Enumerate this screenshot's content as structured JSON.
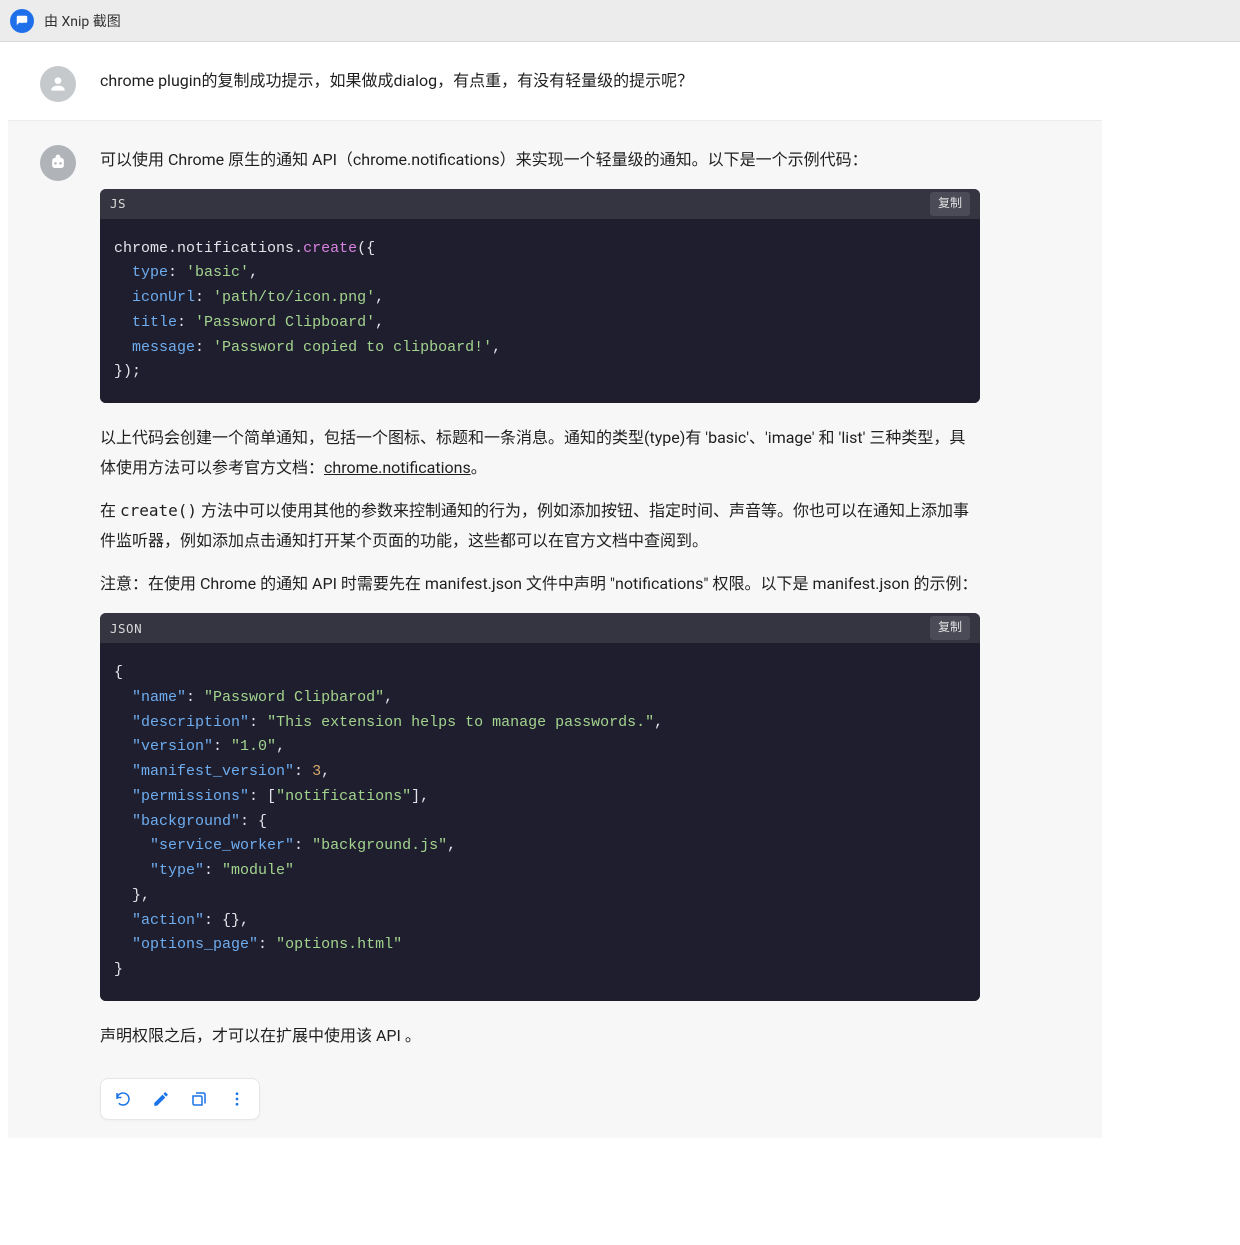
{
  "titlebar": {
    "text": "由 Xnip 截图"
  },
  "user": {
    "text": "chrome plugin的复制成功提示，如果做成dialog，有点重，有没有轻量级的提示呢？"
  },
  "assistant": {
    "intro": "可以使用 Chrome 原生的通知 API（chrome.notifications）来实现一个轻量级的通知。以下是一个示例代码：",
    "code1": {
      "lang": "JS",
      "copy": "复制",
      "lines": {
        "l1a": "chrome",
        "l1b": ".",
        "l1c": "notifications",
        "l1d": ".",
        "l1e": "create",
        "l1f": "({",
        "typeKey": "type",
        "typeVal": "'basic'",
        "iconKey": "iconUrl",
        "iconVal": "'path/to/icon.png'",
        "titleKey": "title",
        "titleVal": "'Password Clipboard'",
        "msgKey": "message",
        "msgVal": "'Password copied to clipboard!'",
        "end": "});"
      }
    },
    "p2a": "以上代码会创建一个简单通知，包括一个图标、标题和一条消息。通知的类型(type)有 'basic'、'image' 和 'list' 三种类型，具体使用方法可以参考官方文档：",
    "p2link": "chrome.notifications",
    "p2b": "。",
    "p3_pre": "在 ",
    "p3_code": "create()",
    "p3_post": " 方法中可以使用其他的参数来控制通知的行为，例如添加按钮、指定时间、声音等。你也可以在通知上添加事件监听器，例如添加点击通知打开某个页面的功能，这些都可以在官方文档中查阅到。",
    "p4": "注意：在使用 Chrome 的通知 API 时需要先在 manifest.json 文件中声明 \"notifications\" 权限。以下是 manifest.json 的示例：",
    "code2": {
      "lang": "JSON",
      "copy": "复制",
      "json": {
        "open": "{",
        "nameK": "\"name\"",
        "nameV": "\"Password Clipbarod\"",
        "descK": "\"description\"",
        "descV": "\"This extension helps to manage passwords.\"",
        "verK": "\"version\"",
        "verV": "\"1.0\"",
        "mvK": "\"manifest_version\"",
        "mvV": "3",
        "permK": "\"permissions\"",
        "permV": "\"notifications\"",
        "bgK": "\"background\"",
        "swK": "\"service_worker\"",
        "swV": "\"background.js\"",
        "typeK": "\"type\"",
        "typeV": "\"module\"",
        "actK": "\"action\"",
        "optK": "\"options_page\"",
        "optV": "\"options.html\"",
        "close": "}"
      }
    },
    "p5": "声明权限之后，才可以在扩展中使用该 API 。"
  },
  "actions": {
    "regenerate": "regenerate-icon",
    "edit": "edit-icon",
    "copy": "copy-icon",
    "more": "more-icon"
  }
}
